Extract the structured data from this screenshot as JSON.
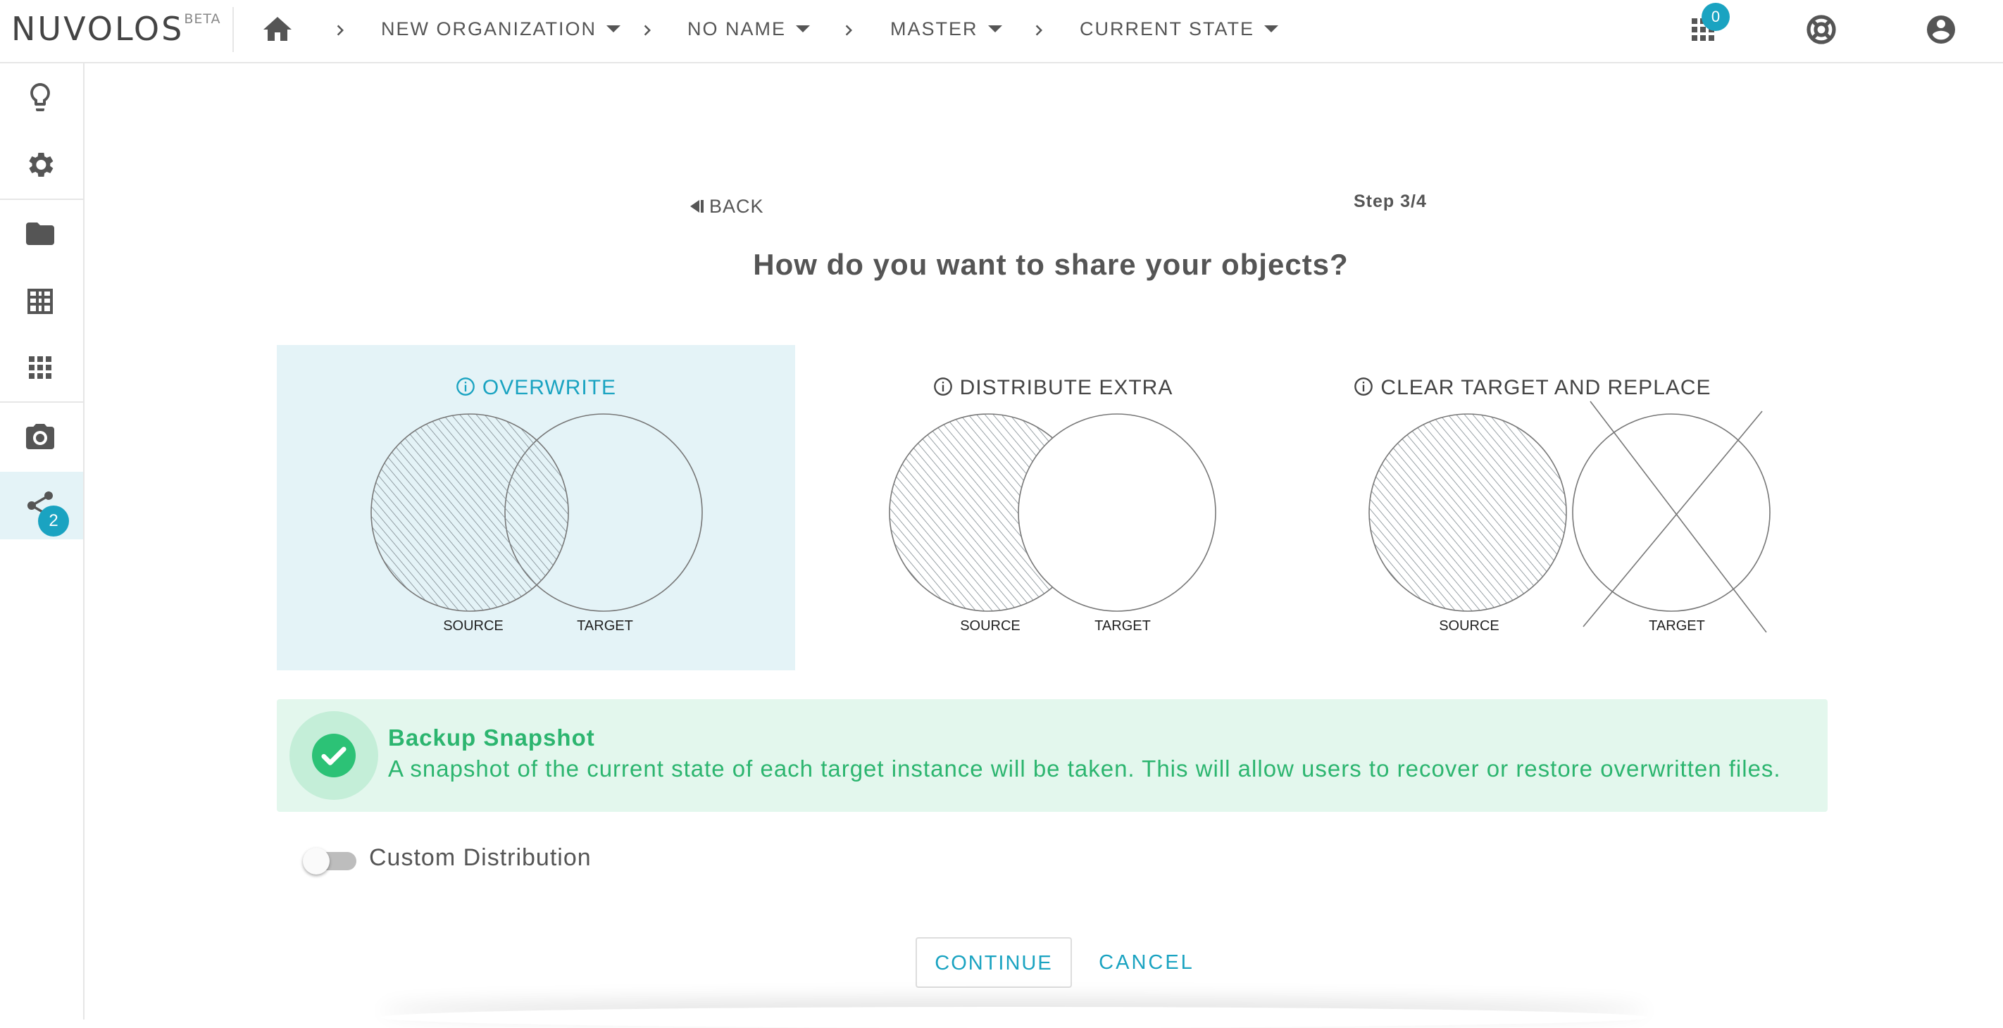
{
  "app": {
    "logo": "NUVOLOS",
    "logo_tag": "BETA"
  },
  "breadcrumbs": [
    {
      "label": "NEW ORGANIZATION"
    },
    {
      "label": "NO NAME"
    },
    {
      "label": "MASTER"
    },
    {
      "label": "CURRENT STATE"
    }
  ],
  "topbar": {
    "apps_badge": "0"
  },
  "sidebar": {
    "share_badge": "2"
  },
  "wizard": {
    "back_label": "BACK",
    "step": "Step 3/4",
    "title": "How do you want to share your objects?",
    "options": [
      {
        "label": "OVERWRITE",
        "source": "SOURCE",
        "target": "TARGET",
        "selected": true
      },
      {
        "label": "DISTRIBUTE EXTRA",
        "source": "SOURCE",
        "target": "TARGET",
        "selected": false
      },
      {
        "label": "CLEAR TARGET AND REPLACE",
        "source": "SOURCE",
        "target": "TARGET",
        "selected": false
      }
    ],
    "snapshot": {
      "title": "Backup Snapshot",
      "text": "A snapshot of the current state of each target instance will be taken. This will allow users to recover or restore overwritten files."
    },
    "custom_distribution": {
      "label": "Custom Distribution",
      "enabled": false
    },
    "continue_label": "CONTINUE",
    "cancel_label": "CANCEL"
  },
  "colors": {
    "accent": "#1aa3c1",
    "success": "#2cb56f",
    "selected_bg": "#e4f3f7"
  }
}
